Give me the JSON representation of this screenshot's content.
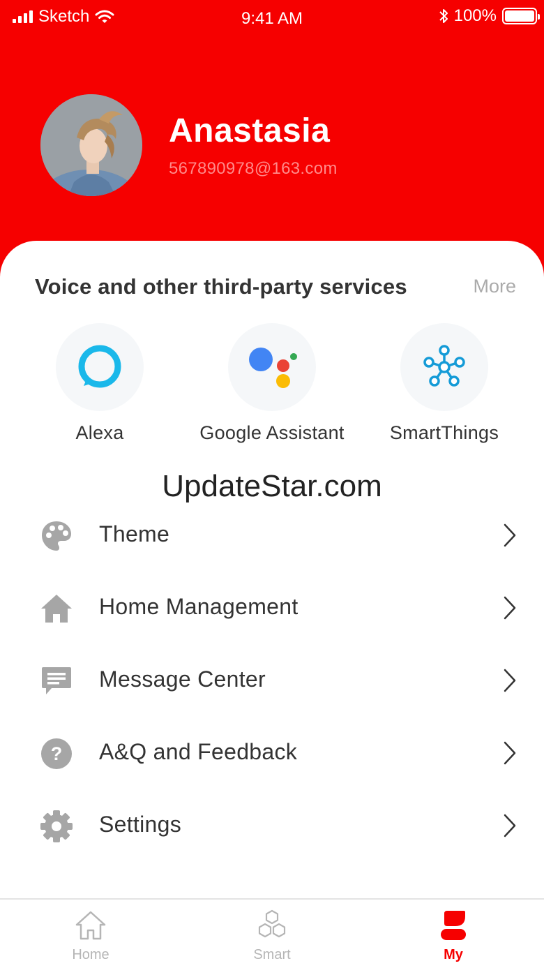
{
  "status_bar": {
    "carrier": "Sketch",
    "time": "9:41 AM",
    "battery": "100%"
  },
  "profile": {
    "name": "Anastasia",
    "email": "567890978@163.com"
  },
  "services": {
    "title": "Voice and other third-party services",
    "more_label": "More",
    "items": [
      {
        "label": "Alexa",
        "icon": "alexa-icon",
        "color": "#1ab8ea"
      },
      {
        "label": "Google Assistant",
        "icon": "google-assistant-icon",
        "colors": [
          "#4285f4",
          "#ea4335",
          "#fbbc05",
          "#34a853"
        ]
      },
      {
        "label": "SmartThings",
        "icon": "smartthings-icon",
        "color": "#159bd7"
      }
    ]
  },
  "watermark": "UpdateStar.com",
  "menu": {
    "items": [
      {
        "label": "Theme",
        "icon": "palette-icon"
      },
      {
        "label": "Home Management",
        "icon": "home-icon"
      },
      {
        "label": "Message Center",
        "icon": "message-icon"
      },
      {
        "label": "A&Q and Feedback",
        "icon": "help-icon"
      },
      {
        "label": "Settings",
        "icon": "gear-icon"
      }
    ]
  },
  "tab_bar": {
    "tabs": [
      {
        "label": "Home",
        "icon": "home-outline-icon",
        "active": false
      },
      {
        "label": "Smart",
        "icon": "hexagons-icon",
        "active": false
      },
      {
        "label": "My",
        "icon": "user-icon",
        "active": true
      }
    ]
  },
  "colors": {
    "brand": "#f60000",
    "icon_gray": "#a6a6a6",
    "tab_inactive": "#b5b5b5"
  }
}
